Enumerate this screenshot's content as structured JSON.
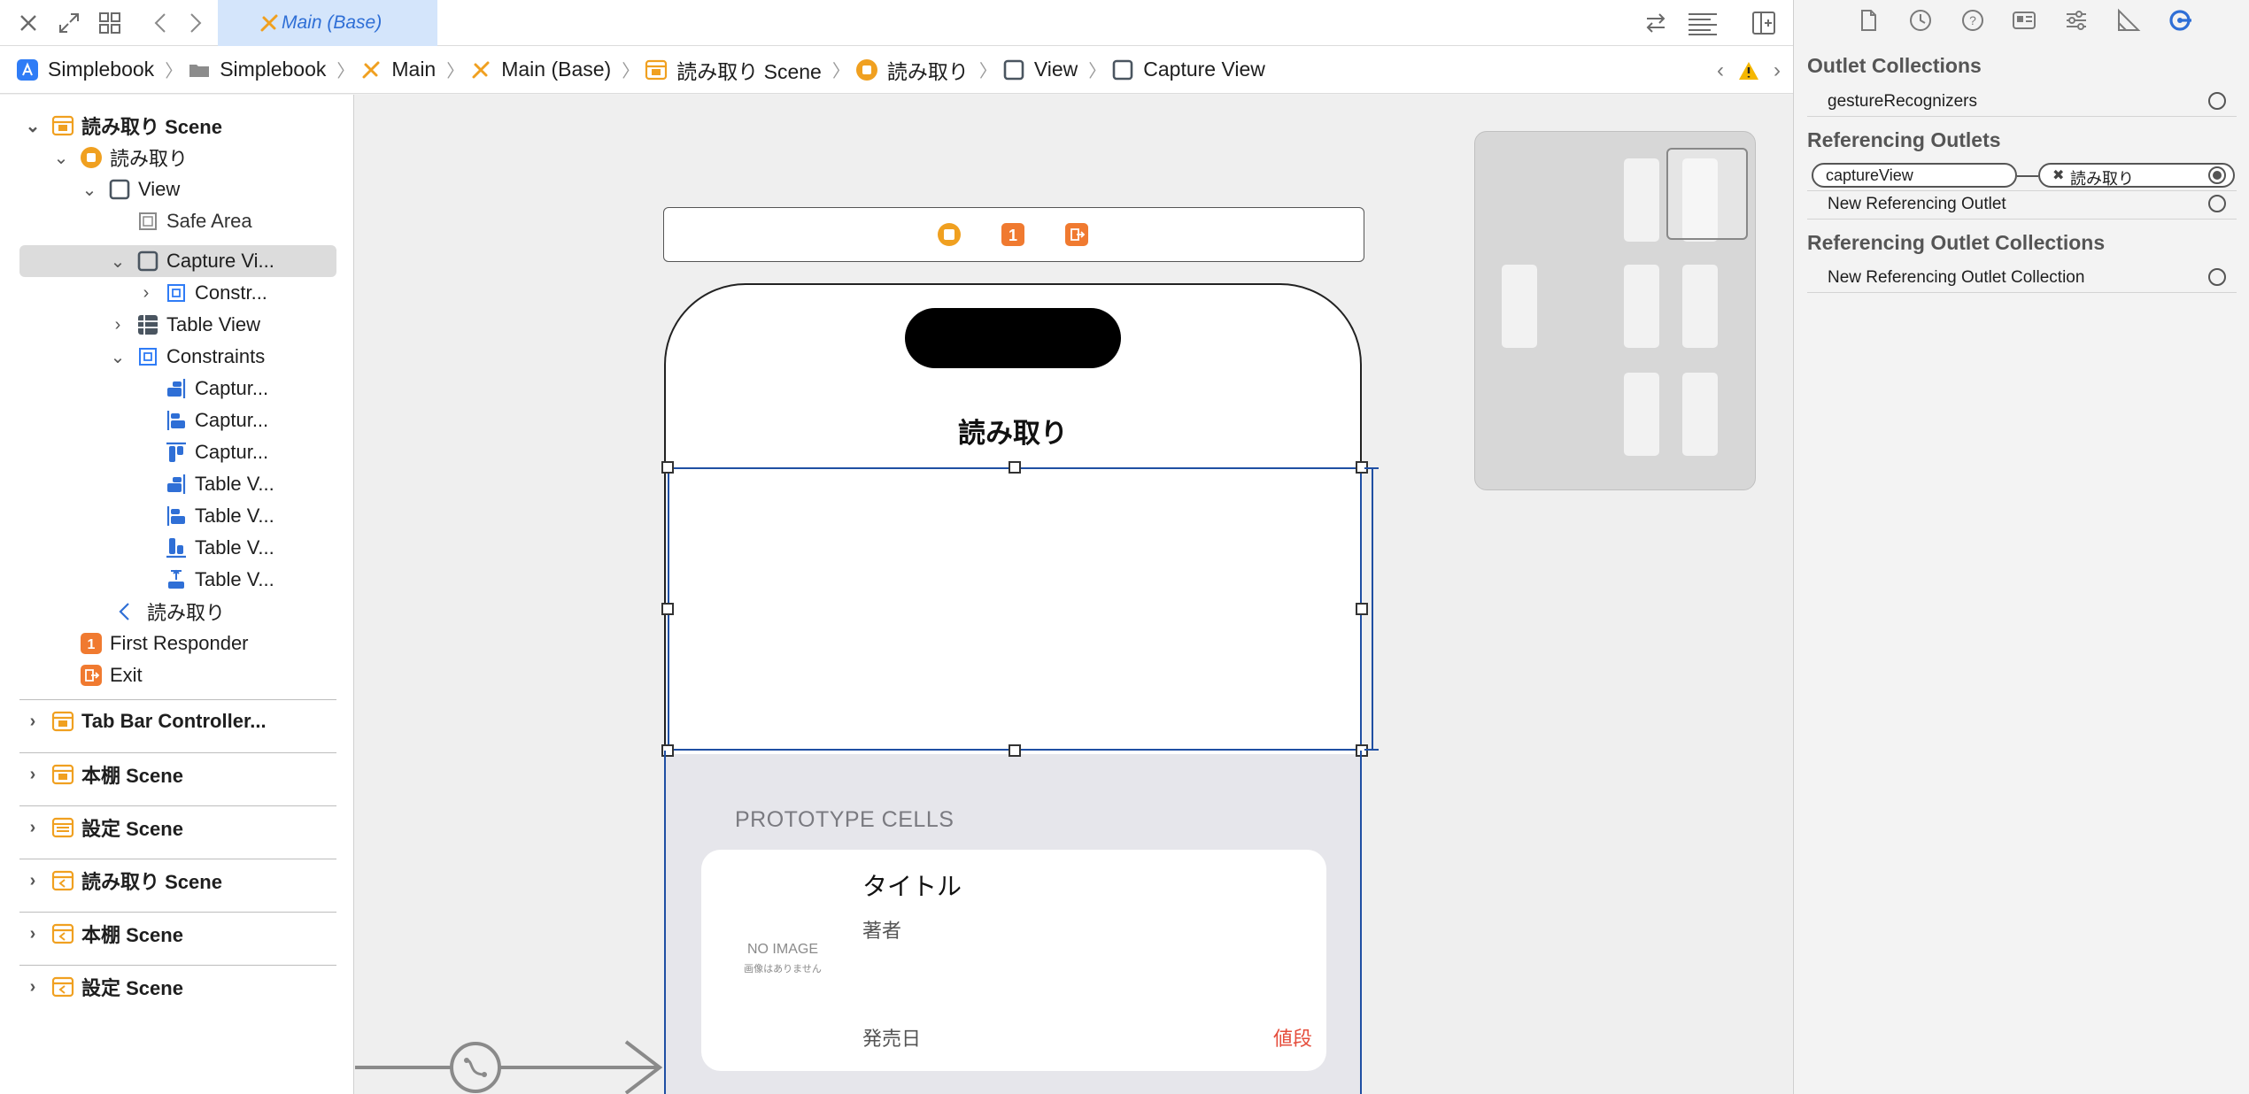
{
  "tabbar": {
    "active_tab": "Main (Base)",
    "icons": [
      "close-icon",
      "expand-icon",
      "grid-icon",
      "back-icon",
      "forward-icon",
      "swap-icon",
      "lines-icon",
      "add-editor-icon"
    ]
  },
  "breadcrumb": {
    "items": [
      "Simplebook",
      "Simplebook",
      "Main",
      "Main (Base)",
      "読み取り Scene",
      "読み取り",
      "View",
      "Capture View"
    ],
    "warning_icon": "warning-icon"
  },
  "outline": {
    "rows": [
      {
        "label": "読み取り Scene"
      },
      {
        "label": "読み取り"
      },
      {
        "label": "View"
      },
      {
        "label": "Safe Area"
      },
      {
        "label": "Capture Vi..."
      },
      {
        "label": "Constr..."
      },
      {
        "label": "Table View"
      },
      {
        "label": "Constraints"
      },
      {
        "label": "Captur..."
      },
      {
        "label": "Captur..."
      },
      {
        "label": "Captur..."
      },
      {
        "label": "Table V..."
      },
      {
        "label": "Table V..."
      },
      {
        "label": "Table V..."
      },
      {
        "label": "Table V..."
      },
      {
        "label": "読み取り"
      },
      {
        "label": "First Responder"
      },
      {
        "label": "Exit"
      }
    ],
    "scenes": [
      "Tab Bar Controller...",
      "本棚 Scene",
      "設定 Scene",
      "読み取り Scene",
      "本棚 Scene",
      "設定 Scene"
    ]
  },
  "canvas": {
    "nav_title": "読み取り",
    "prototype_label": "PROTOTYPE CELLS",
    "cell": {
      "no_image": "NO IMAGE",
      "no_image_sub": "画像はありません",
      "title": "タイトル",
      "author": "著者",
      "date": "発売日",
      "price": "値段"
    },
    "dock_icons": [
      "view-controller-icon",
      "first-responder-icon",
      "exit-icon"
    ]
  },
  "inspector": {
    "tabs": [
      "file-icon",
      "history-icon",
      "help-icon",
      "identity-icon",
      "attributes-icon",
      "size-icon",
      "connections-icon"
    ],
    "outlet_collections_title": "Outlet Collections",
    "gesture_recognizers": "gestureRecognizers",
    "referencing_outlets_title": "Referencing Outlets",
    "capture_view": "captureView",
    "connected_to": "読み取り",
    "new_referencing_outlet": "New Referencing Outlet",
    "referencing_outlet_collections_title": "Referencing Outlet Collections",
    "new_referencing_outlet_collection": "New Referencing Outlet Collection"
  },
  "colors": {
    "accent_blue": "#2f6fd6",
    "xcode_orange": "#f0a020",
    "selection_blue": "#1f4fa3",
    "price_red": "#e54d3c"
  }
}
